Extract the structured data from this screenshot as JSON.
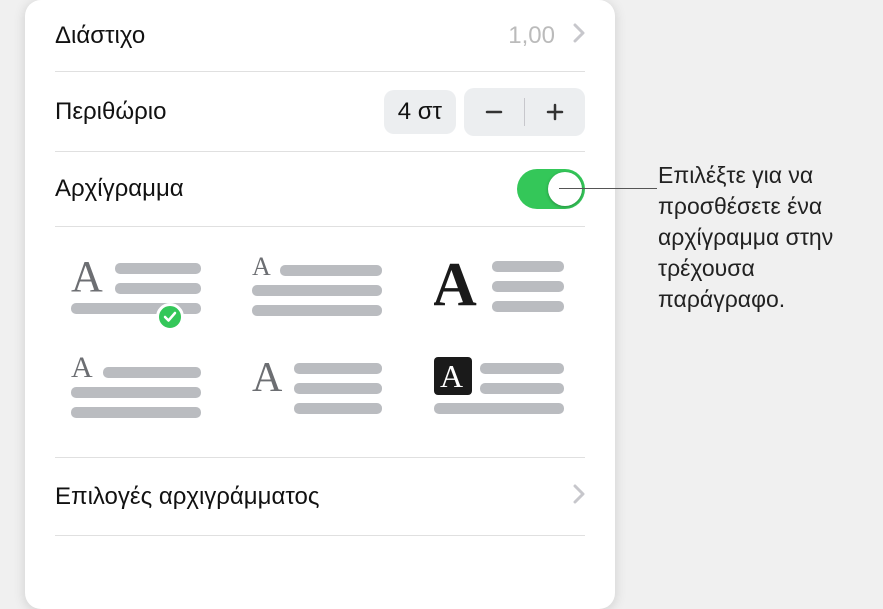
{
  "rows": {
    "lineSpacing": {
      "label": "Διάστιχο",
      "value": "1,00"
    },
    "margin": {
      "label": "Περιθώριο",
      "value": "4 στ"
    },
    "dropCap": {
      "label": "Αρχίγραμμα"
    },
    "options": {
      "label": "Επιλογές αρχιγράμματος"
    }
  },
  "callout": "Επιλέξτε για να προσθέσετε ένα αρχίγραμμα στην τρέχουσα παράγραφο."
}
